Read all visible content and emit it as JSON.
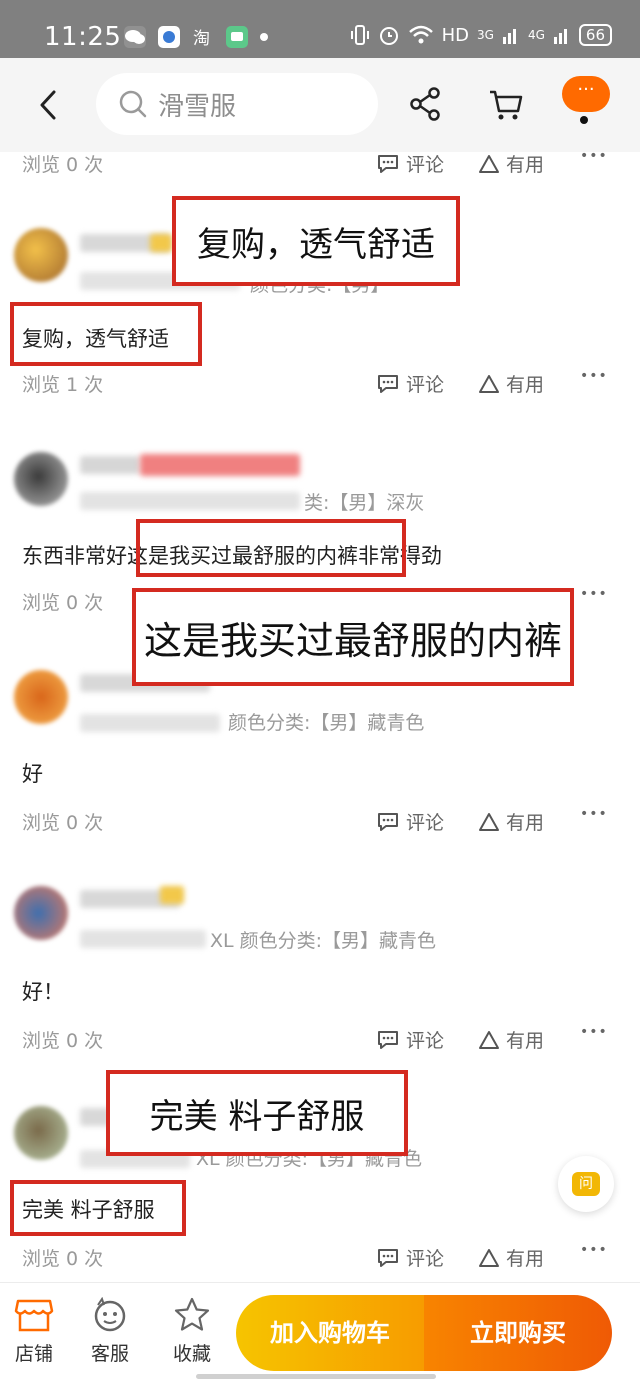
{
  "status_bar": {
    "time": "11:25",
    "network": "HD",
    "signal_a": "3G",
    "signal_b": "4G",
    "battery": "66"
  },
  "header": {
    "search_placeholder": "滑雪服"
  },
  "actions": {
    "comment": "评论",
    "useful": "有用",
    "more": "•••"
  },
  "reviews": [
    {
      "views": "浏览 0 次"
    },
    {
      "meta": "颜色分类:【男】",
      "content": "复购，透气舒适",
      "views": "浏览 1 次"
    },
    {
      "meta": "类:【男】深灰",
      "content_a": "东西非常好",
      "content_b": "这是我买过最舒服的内裤",
      "content_c": "非常得劲",
      "views": "浏览 0 次"
    },
    {
      "meta": "颜色分类:【男】藏青色",
      "content": "好",
      "views": "浏览 0 次"
    },
    {
      "meta": "XL 颜色分类:【男】藏青色",
      "content": "好！",
      "views": "浏览 0 次"
    },
    {
      "meta": "XL 颜色分类:【男】藏青色",
      "content": "完美 料子舒服",
      "views": "浏览 0 次"
    }
  ],
  "annotations": {
    "a1": "复购，透气舒适",
    "a2": "这是我买过最舒服的内裤",
    "a3": "完美 料子舒服"
  },
  "ask_button": "问",
  "bottom_bar": {
    "shop": "店铺",
    "service": "客服",
    "favorite": "收藏",
    "add_to_cart": "加入购物车",
    "buy_now": "立即购买"
  },
  "colors": {
    "accent": "#ff6a00",
    "annotation_border": "#d42a20",
    "cart_gradient": "#f6c400",
    "buy_gradient": "#ef5a05"
  }
}
